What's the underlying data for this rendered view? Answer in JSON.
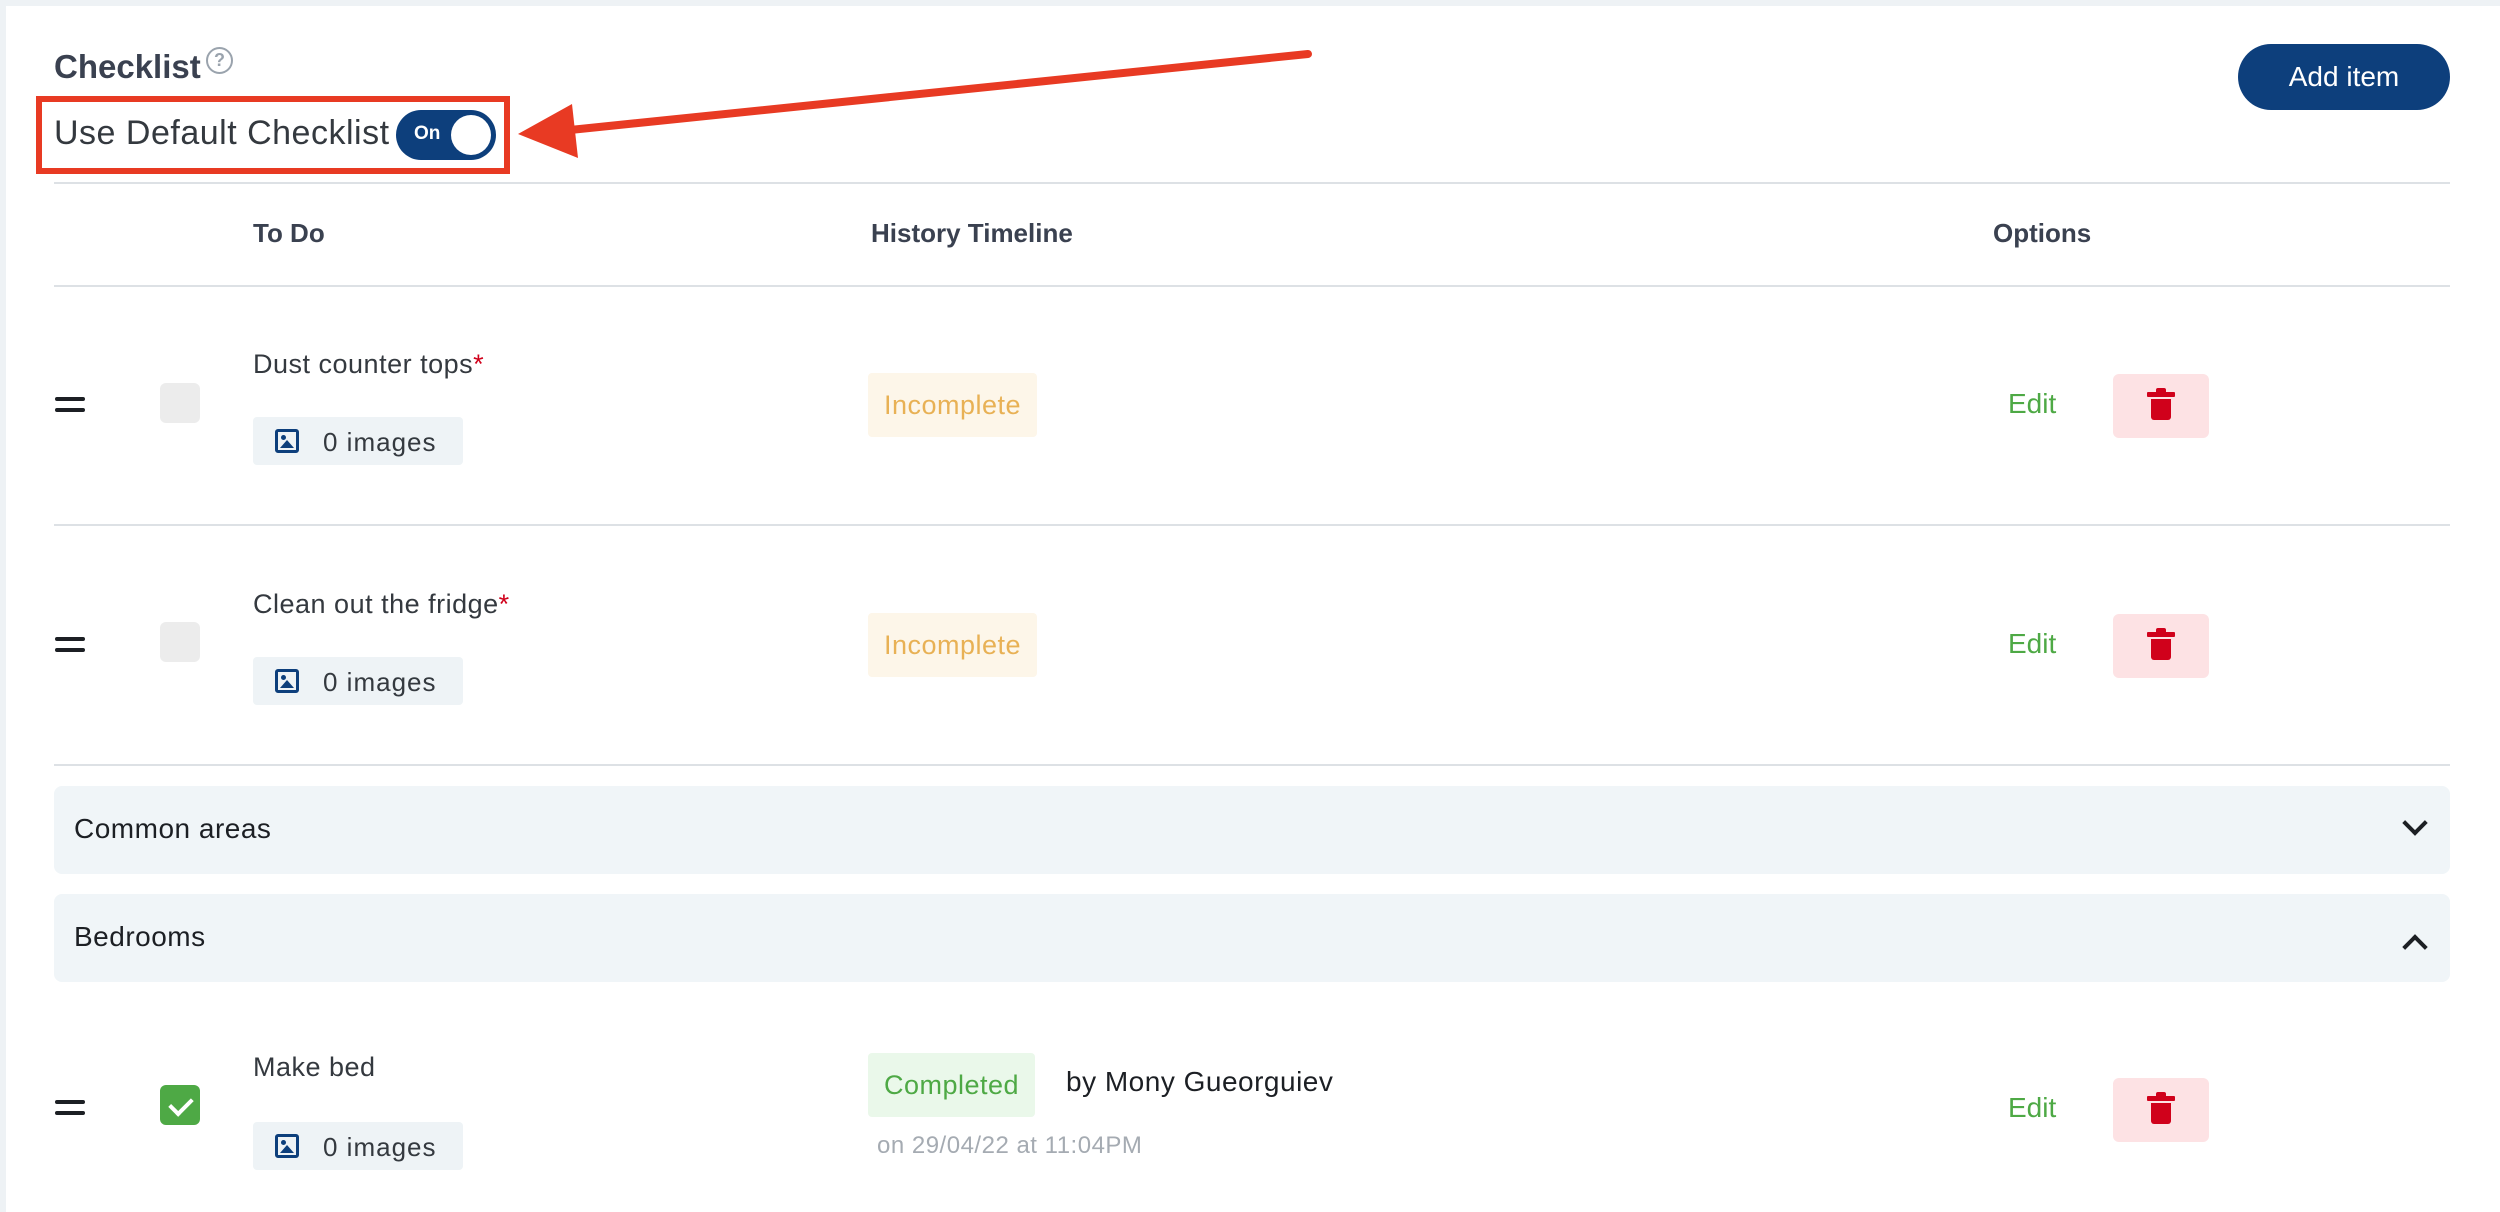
{
  "header": {
    "title": "Checklist",
    "help_icon": "question-circle-icon",
    "default_label": "Use Default Checklist",
    "toggle_state": "On",
    "add_button": "Add item"
  },
  "columns": {
    "todo": "To Do",
    "history": "History Timeline",
    "options": "Options"
  },
  "rows": [
    {
      "name": "Dust counter tops",
      "required": "*",
      "images": "0 images",
      "status": "Incomplete",
      "checked": false,
      "edit": "Edit"
    },
    {
      "name": "Clean out the fridge",
      "required": "*",
      "images": "0 images",
      "status": "Incomplete",
      "checked": false,
      "edit": "Edit"
    }
  ],
  "sections": [
    {
      "label": "Common areas",
      "state": "collapsed"
    },
    {
      "label": "Bedrooms",
      "state": "expanded"
    }
  ],
  "bedroom_rows": [
    {
      "name": "Make bed",
      "images": "0 images",
      "status": "Completed",
      "by": "by Mony Gueorguiev",
      "on": "on 29/04/22 at 11:04PM",
      "checked": true,
      "edit": "Edit"
    }
  ],
  "colors": {
    "primary": "#0d3f7c",
    "annotation": "#e83a23",
    "incomplete": "#e8b155",
    "completed": "#4ea945",
    "delete": "#d0011b"
  }
}
